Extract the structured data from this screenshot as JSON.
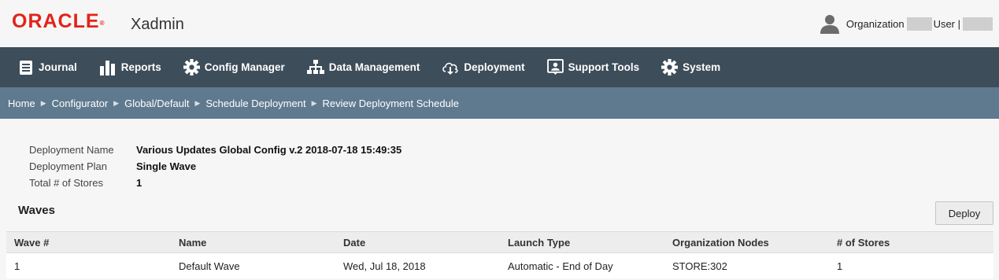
{
  "header": {
    "logo": "ORACLE",
    "logo_mark": "®",
    "app_name": "Xadmin",
    "org_label": "Organization",
    "user_label": "User |",
    "user_icon": "user-avatar-icon"
  },
  "nav": {
    "items": [
      {
        "label": "Journal",
        "icon": "journal-icon"
      },
      {
        "label": "Reports",
        "icon": "bar-chart-icon"
      },
      {
        "label": "Config Manager",
        "icon": "gear-icon"
      },
      {
        "label": "Data Management",
        "icon": "hierarchy-icon"
      },
      {
        "label": "Deployment",
        "icon": "cloud-download-icon"
      },
      {
        "label": "Support Tools",
        "icon": "support-icon"
      },
      {
        "label": "System",
        "icon": "gear-icon"
      }
    ]
  },
  "breadcrumb": {
    "items": [
      "Home",
      "Configurator",
      "Global/Default",
      "Schedule Deployment",
      "Review Deployment Schedule"
    ]
  },
  "details": {
    "name_label": "Deployment Name",
    "name_value": "Various Updates Global Config v.2 2018-07-18 15:49:35",
    "plan_label": "Deployment Plan",
    "plan_value": "Single Wave",
    "stores_label": "Total # of Stores",
    "stores_value": "1"
  },
  "waves": {
    "title": "Waves",
    "deploy_label": "Deploy",
    "columns": [
      "Wave #",
      "Name",
      "Date",
      "Launch Type",
      "Organization Nodes",
      "# of Stores"
    ],
    "rows": [
      [
        "1",
        "Default Wave",
        "Wed, Jul 18, 2018",
        "Automatic - End of Day",
        "STORE:302",
        "1"
      ]
    ]
  },
  "colors": {
    "brand_red": "#e2231a",
    "nav_bg": "#3d4d5a",
    "breadcrumb_bg": "#5f7a8f"
  }
}
